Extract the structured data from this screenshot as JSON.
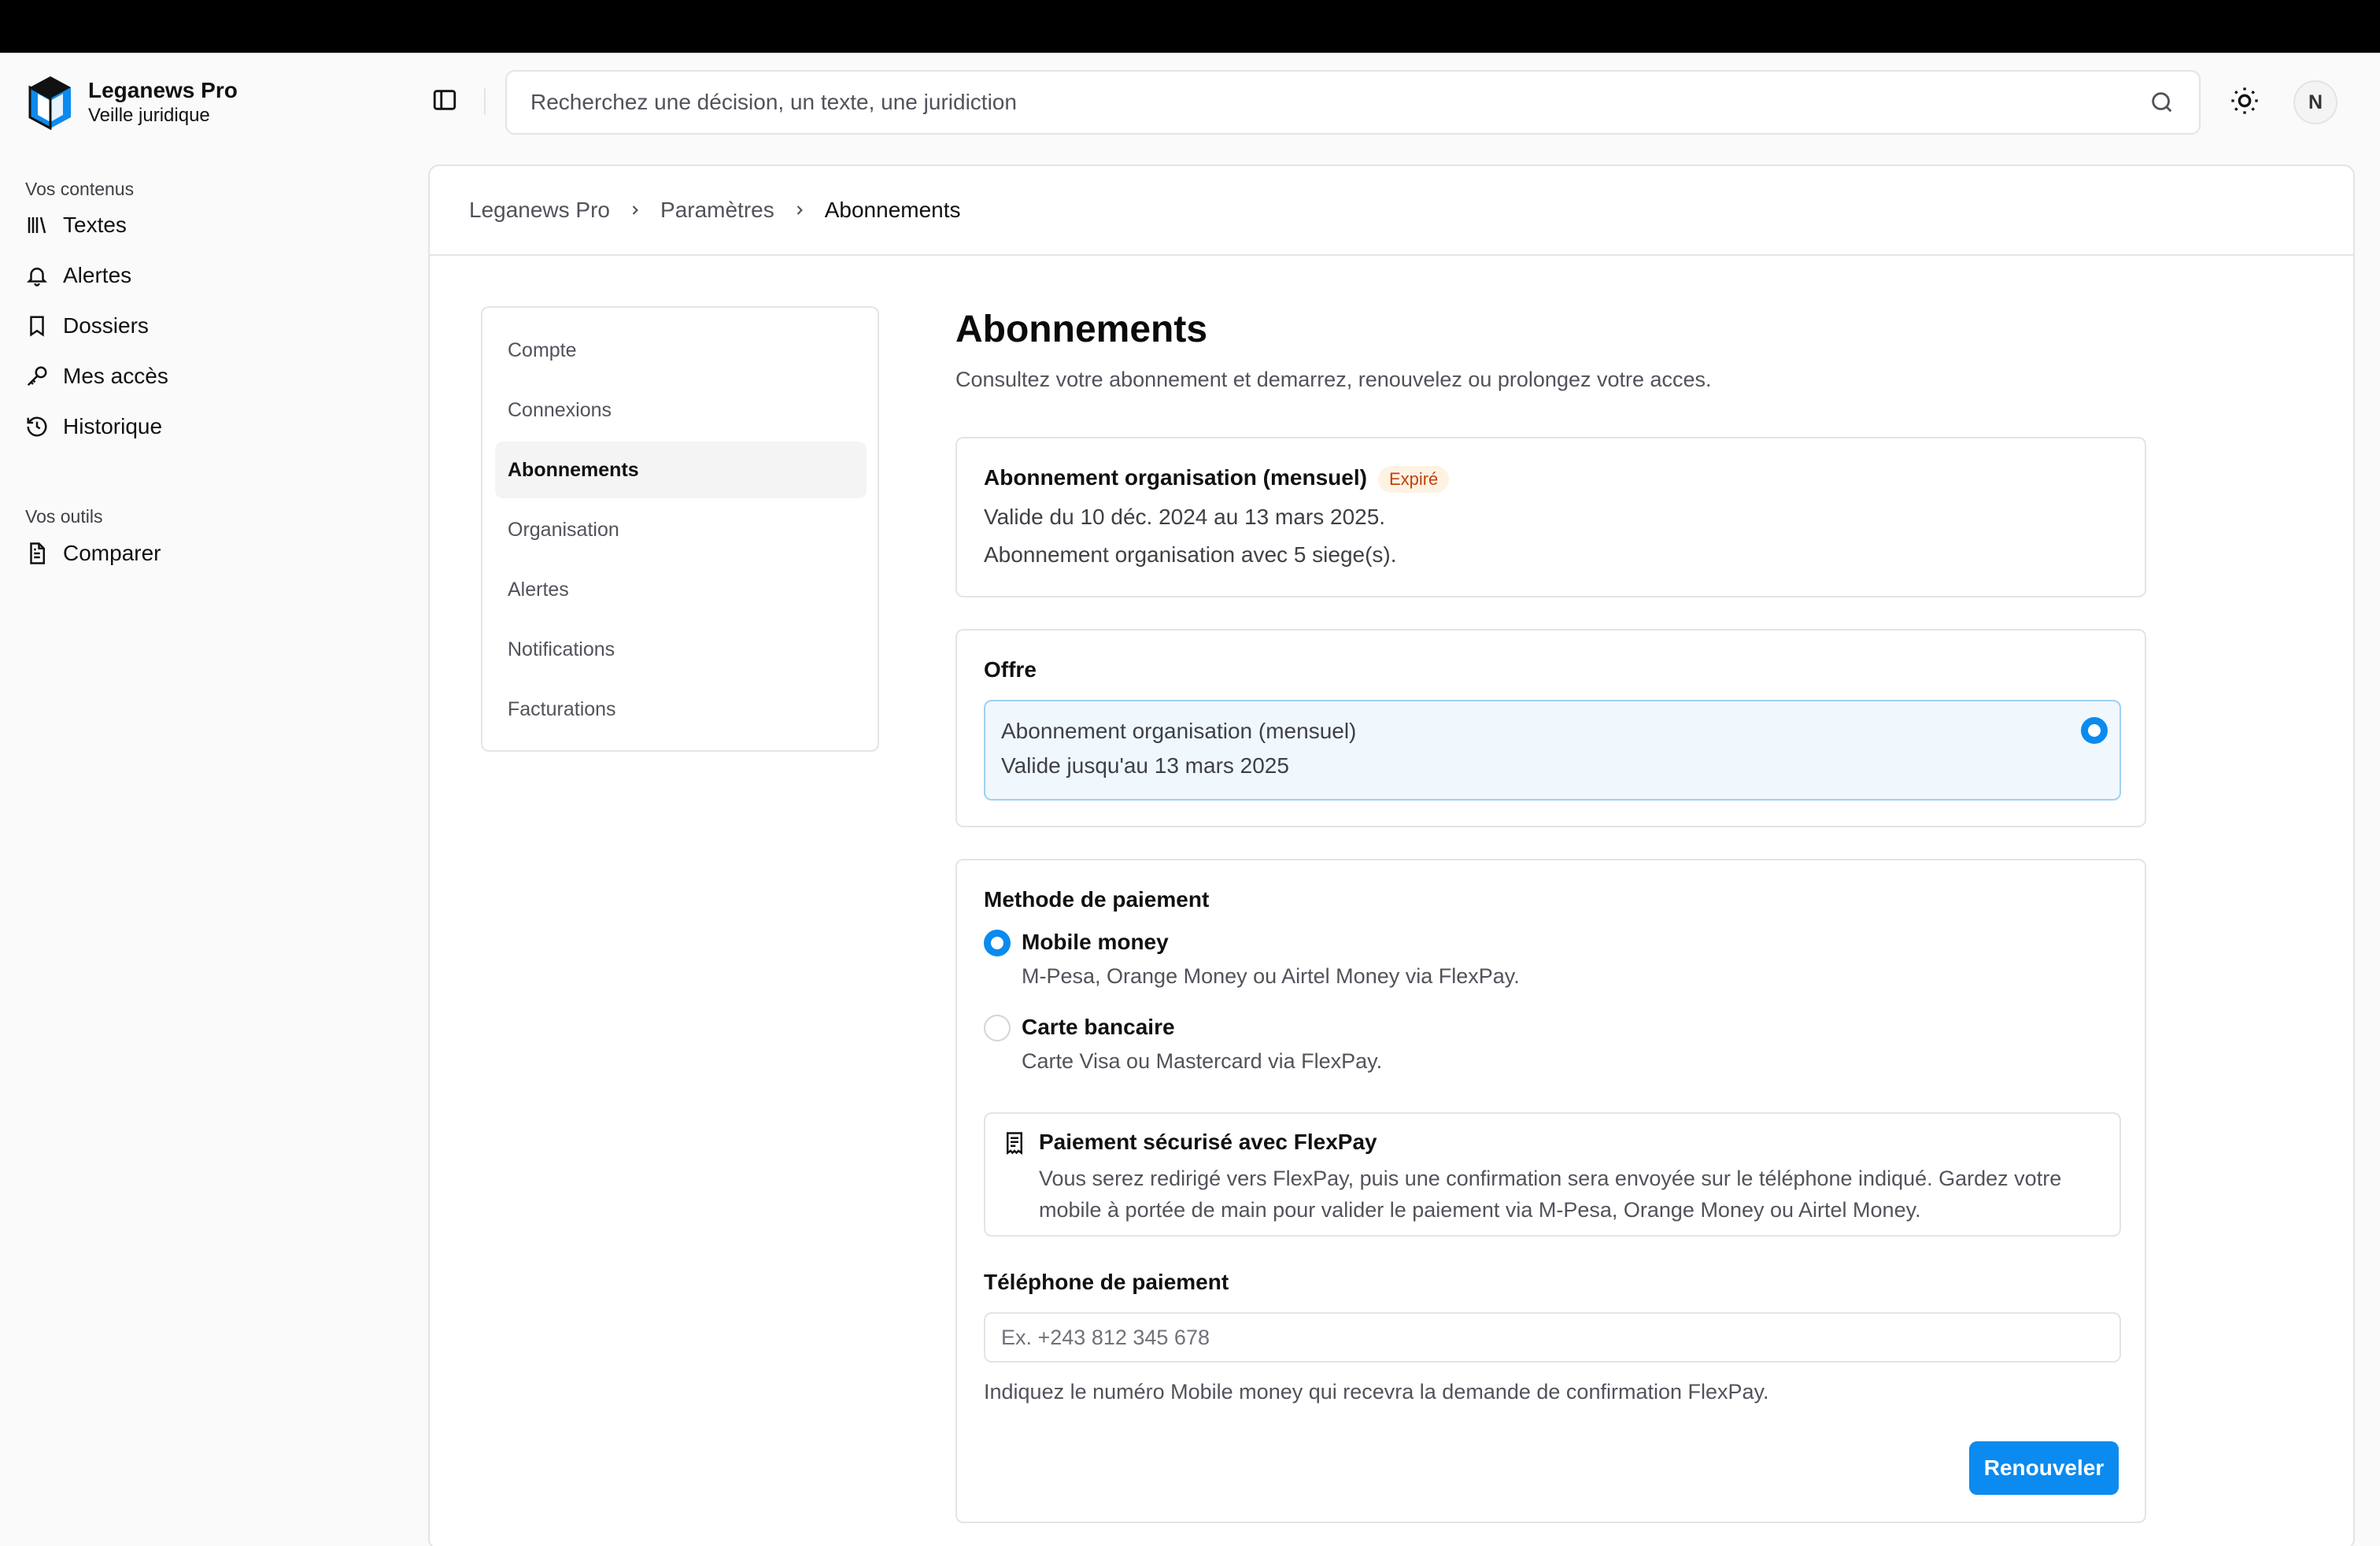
{
  "brand": {
    "name": "Leganews Pro",
    "subtitle": "Veille juridique"
  },
  "sidebar": {
    "group1": "Vos contenus",
    "items": [
      {
        "label": "Textes",
        "icon": "library-icon"
      },
      {
        "label": "Alertes",
        "icon": "bell-icon"
      },
      {
        "label": "Dossiers",
        "icon": "bookmark-icon"
      },
      {
        "label": "Mes accès",
        "icon": "key-icon"
      },
      {
        "label": "Historique",
        "icon": "history-icon"
      }
    ],
    "group2": "Vos outils",
    "tools": [
      {
        "label": "Comparer",
        "icon": "document-icon"
      }
    ]
  },
  "header": {
    "search_placeholder": "Recherchez une décision, un texte, une juridiction",
    "avatar_initial": "N"
  },
  "breadcrumb": [
    "Leganews Pro",
    "Paramètres",
    "Abonnements"
  ],
  "settings_nav": [
    "Compte",
    "Connexions",
    "Abonnements",
    "Organisation",
    "Alertes",
    "Notifications",
    "Facturations"
  ],
  "settings_active": "Abonnements",
  "page": {
    "title": "Abonnements",
    "description": "Consultez votre abonnement et demarrez, renouvelez ou prolongez votre acces."
  },
  "subscription": {
    "title": "Abonnement organisation (mensuel)",
    "status": "Expiré",
    "validity": "Valide du 10 déc. 2024 au 13 mars 2025.",
    "seats": "Abonnement organisation avec 5 siege(s)."
  },
  "offer": {
    "label": "Offre",
    "name": "Abonnement organisation (mensuel)",
    "validity": "Valide jusqu'au 13 mars 2025",
    "selected": true
  },
  "payment": {
    "label": "Methode de paiement",
    "methods": [
      {
        "name": "Mobile money",
        "desc": "M-Pesa, Orange Money ou Airtel Money via FlexPay.",
        "selected": true
      },
      {
        "name": "Carte bancaire",
        "desc": "Carte Visa ou Mastercard via FlexPay.",
        "selected": false
      }
    ],
    "info_title": "Paiement sécurisé avec FlexPay",
    "info_text": "Vous serez redirigé vers FlexPay, puis une confirmation sera envoyée sur le téléphone indiqué. Gardez votre mobile à portée de main pour valider le paiement via M-Pesa, Orange Money ou Airtel Money.",
    "phone_label": "Téléphone de paiement",
    "phone_placeholder": "Ex. +243 812 345 678",
    "phone_value": "",
    "phone_help": "Indiquez le numéro Mobile money qui recevra la demande de confirmation FlexPay.",
    "submit_label": "Renouveler"
  },
  "colors": {
    "accent": "#0b8bef",
    "expired_text": "#c2410c",
    "expired_bg": "#fef3e2",
    "offer_bg": "#f0f8fe"
  }
}
